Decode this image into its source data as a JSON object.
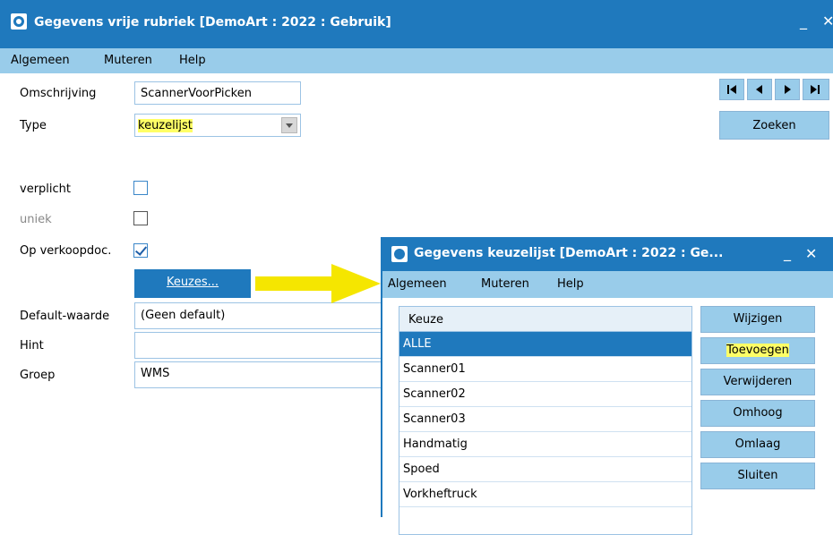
{
  "main": {
    "title": "Gegevens vrije rubriek  [DemoArt : 2022 : Gebruik]",
    "minimize": "_",
    "close": "✕",
    "menu": [
      "Algemeen",
      "Muteren",
      "Help"
    ],
    "labels": {
      "omschrijving": "Omschrijving",
      "type": "Type",
      "verplicht": "verplicht",
      "uniek": "uniek",
      "opverkoop": "Op verkoopdoc.",
      "default": "Default-waarde",
      "hint": "Hint",
      "groep": "Groep"
    },
    "values": {
      "omschrijving": "ScannerVoorPicken",
      "type": "keuzelijst",
      "default": "(Geen default)",
      "hint": "",
      "groep": "WMS"
    },
    "checks": {
      "verplicht": false,
      "uniek": false,
      "opverkoop": true
    },
    "keuzes_button": "Keuzes...",
    "zoeken_button": "Zoeken"
  },
  "sub": {
    "title": "Gegevens keuzelijst  [DemoArt : 2022 : Ge...",
    "minimize": "_",
    "close": "✕",
    "menu": [
      "Algemeen",
      "Muteren",
      "Help"
    ],
    "list_header": "Keuze",
    "items": [
      "ALLE",
      "Scanner01",
      "Scanner02",
      "Scanner03",
      "Handmatig",
      "Spoed",
      "Vorkheftruck"
    ],
    "buttons": {
      "wijzigen": "Wijzigen",
      "toevoegen": "Toevoegen",
      "verwijderen": "Verwijderen",
      "omhoog": "Omhoog",
      "omlaag": "Omlaag",
      "sluiten": "Sluiten"
    }
  },
  "colors": {
    "titlebar": "#1f79bd",
    "menubar": "#99ccea",
    "highlight": "#ffff66",
    "arrow": "#f5e600"
  }
}
